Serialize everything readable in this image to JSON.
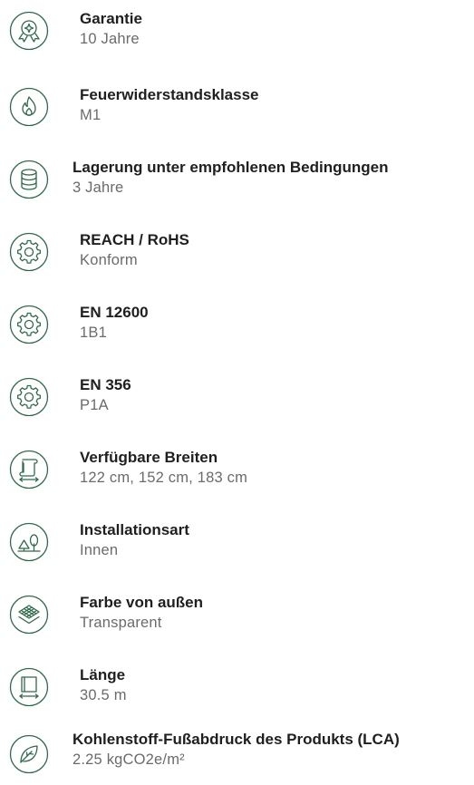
{
  "specs": [
    {
      "label": "Garantie",
      "value": "10 Jahre",
      "icon": "award-icon"
    },
    {
      "label": "Feuerwiderstandsklasse",
      "value": "M1",
      "icon": "flame-icon"
    },
    {
      "label": "Lagerung unter empfohlenen Bedingungen",
      "value": "3 Jahre",
      "icon": "database-icon"
    },
    {
      "label": "REACH / RoHS",
      "value": "Konform",
      "icon": "gear-icon"
    },
    {
      "label": "EN 12600",
      "value": "1B1",
      "icon": "gear-icon"
    },
    {
      "label": "EN 356",
      "value": "P1A",
      "icon": "gear-icon"
    },
    {
      "label": "Verfügbare Breiten",
      "value": "122 cm, 152 cm, 183 cm",
      "icon": "width-roll-icon"
    },
    {
      "label": "Installationsart",
      "value": "Innen",
      "icon": "indoor-tree-icon"
    },
    {
      "label": "Farbe von außen",
      "value": "Transparent",
      "icon": "layers-icon"
    },
    {
      "label": "Länge",
      "value": "30.5 m",
      "icon": "length-icon"
    },
    {
      "label": "Kohlenstoff-Fußabdruck des Produkts (LCA)",
      "value": "2.25 kgCO2e/m²",
      "icon": "leaf-icon"
    }
  ],
  "colors": {
    "icon_stroke": "#2e6b4a",
    "label": "#1f1f1f",
    "value": "#6b6b6b"
  }
}
